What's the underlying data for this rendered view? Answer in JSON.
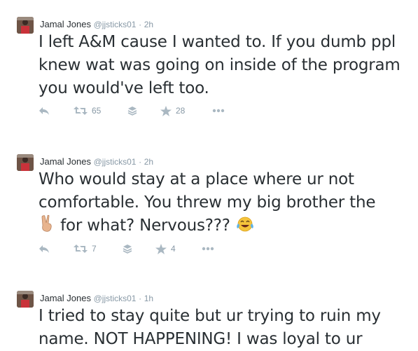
{
  "tweets": [
    {
      "author_name": "Jamal Jones",
      "handle": "@jjsticks01",
      "separator": "·",
      "time": "2h",
      "text": "I left A&M cause I wanted to. If you dumb ppl knew wat was going on inside of the program you would've left too.",
      "retweets": "65",
      "favorites": "28"
    },
    {
      "author_name": "Jamal Jones",
      "handle": "@jjsticks01",
      "separator": "·",
      "time": "2h",
      "text_line1": "Who would stay at a place where ur not comfortable. You threw my big brother the",
      "text_line2": "for what? Nervous???",
      "retweets": "7",
      "favorites": "4"
    },
    {
      "author_name": "Jamal Jones",
      "handle": "@jjsticks01",
      "separator": "·",
      "time": "1h",
      "text": "I tried to stay quite but ur trying to ruin my name. NOT HAPPENING! I was loyal to ur"
    }
  ],
  "icons": {
    "reply": "reply-icon",
    "retweet": "retweet-icon",
    "stack": "stack-icon",
    "favorite": "star-icon",
    "more": "more-dots-icon",
    "peace": "victory-hand-emoji",
    "laugh": "tears-of-joy-emoji"
  },
  "colors": {
    "text": "#292f33",
    "meta": "#8899a6",
    "action": "#aab8c2"
  }
}
